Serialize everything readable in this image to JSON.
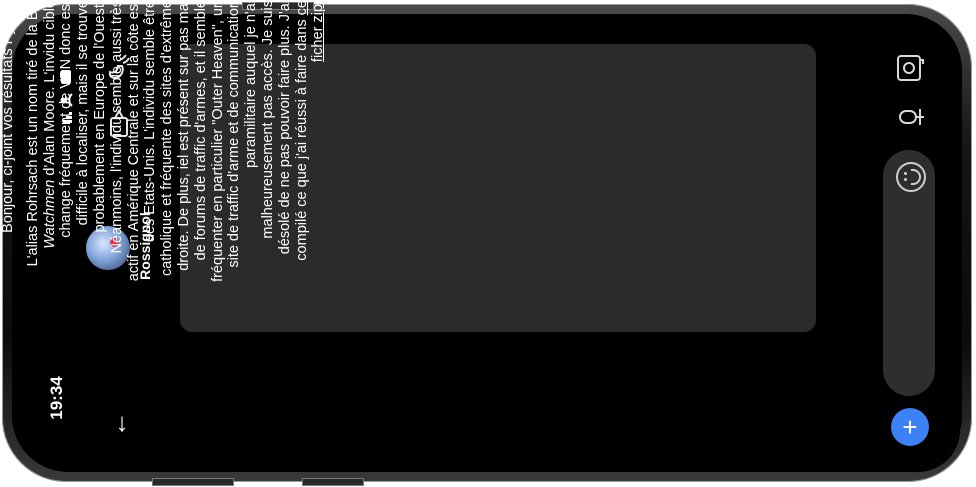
{
  "status_bar": {
    "time": "19:34"
  },
  "contact": {
    "name": "Rossignol"
  },
  "message": {
    "greeting": "Bonjour, ci-joint vos résultats Pythia!",
    "body_before_title": "L'alias Rohrsach est un nom tiré de la BD ",
    "title": "Watchmen",
    "body_after_title": " d'Alan Moore. L'invidu ciblé change fréquement de VPN donc est difficile à localiser, mais il se trouve probablement en Europe de l'Ouest. Néanmoins, l'individu semble aussi très actif en Amérique Centrale et sur la côte est des Etats-Unis. L'individu semble être catholique et fréquente des sites d'extrême droite. De plus, iel est présent sur pas mal de forums de traffic d'armes, et il semble fréquenter en particulier \"Outer Heaven\", un site de traffic d'arme et de communication paramilitaire auquel je n'ai malheureusement pas accès.  Je suis désolé de ne pas pouvoir faire plus. J'ai compilé ce que j'ai réussi à faire dans ",
    "link_text": "ce ficher zip."
  },
  "colors": {
    "accent": "#3b82f6",
    "bubble": "#2b2b2d",
    "screen": "#000000"
  },
  "icons": [
    "signal-icon",
    "wifi-icon",
    "battery-icon",
    "back-arrow-icon",
    "video-call-icon",
    "phone-call-icon",
    "emoji-icon",
    "plus-icon",
    "microphone-icon",
    "camera-icon"
  ]
}
